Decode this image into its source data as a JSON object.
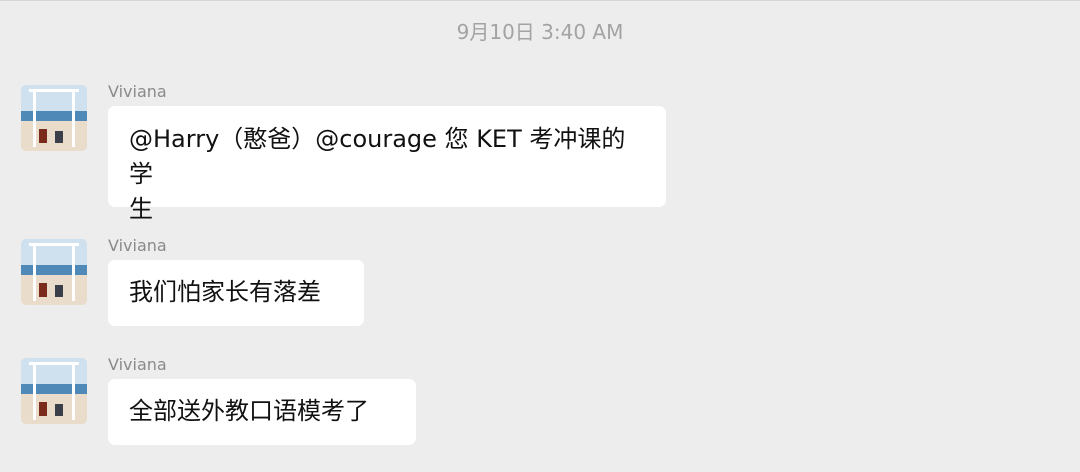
{
  "chat": {
    "timestamp": "9月10日 3:40 AM",
    "messages": [
      {
        "sender": "Viviana",
        "text_line1": "@Harry（憨爸）@courage 您 KET 考冲课的学",
        "text_line2": "生"
      },
      {
        "sender": "Viviana",
        "text": "我们怕家长有落差"
      },
      {
        "sender": "Viviana",
        "text": "全部送外教口语模考了"
      }
    ]
  },
  "colors": {
    "background": "#ededed",
    "bubble": "#ffffff",
    "timestamp": "#a3a3a3",
    "sender": "#8a8a8a",
    "message_text": "#111111"
  },
  "icons": {
    "avatar": "beach-swing-avatar"
  }
}
